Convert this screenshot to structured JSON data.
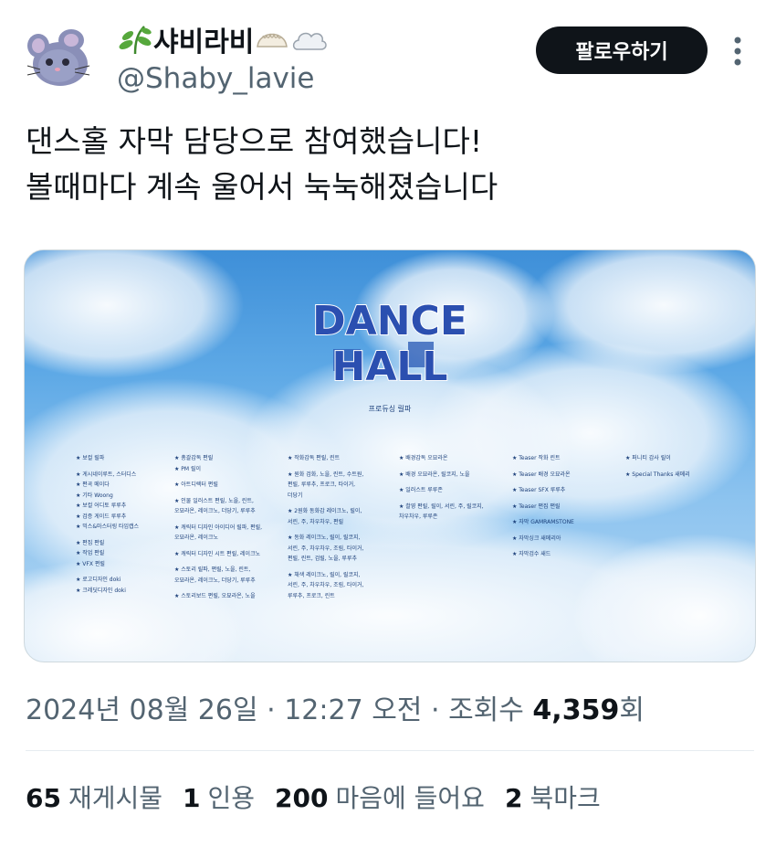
{
  "user": {
    "display_name": "샤비라비",
    "handle": "@Shaby_lavie",
    "avatar_icon": "chinchilla-avatar-icon",
    "name_icons": [
      "herb-icon",
      "dumpling-icon",
      "cloud-icon"
    ]
  },
  "actions": {
    "follow_label": "팔로우하기",
    "more_icon": "more-vertical-icon"
  },
  "tweet": {
    "lines": [
      "댄스홀 자막 담당으로 참여했습니다!",
      "볼때마다 계속 울어서 눅눅해졌습니다"
    ]
  },
  "media": {
    "logo_line1": "DANCE",
    "logo_line2": "HALL",
    "producer": "프로듀싱 릴파",
    "columns": [
      [
        [
          "★ 보컬 릴파"
        ],
        [
          "★ 게시네이루트, 스터디스",
          "★ 편곡 메이다",
          "★ 기타 Woong",
          "★ 보컬 어디토 루루추",
          "★ 검증 게이드 루루추",
          "★ 믹스&마스터링 타임캡스"
        ],
        [
          "★ 편집 편릴",
          "★ 작업 편릴",
          "★ VFX 편릴"
        ],
        [
          "★ 로고디자인 doki",
          "★ 크레딧디자인 doki"
        ]
      ],
      [
        [
          "★ 총괄감독 편릴",
          "★ PM 릴이"
        ],
        [
          "★ 아트디렉터 편릴"
        ],
        [
          "★ 인물 일러스트 편릴, 노을, 린트,",
          "   오묘라온, 레이크노, 더당기, 루루추"
        ],
        [
          "★ 캐릭터 디자인 아이디어 릴파, 편릴,",
          "   오묘라온, 레이크노"
        ],
        [
          "★ 캐릭터 디자인 시트 편릴, 레이크노"
        ],
        [
          "★ 스토리 릴파, 편릴, 노을, 린트,",
          "   오묘라온, 레이크노, 더당기, 루루추"
        ],
        [
          "★ 스토리보드 편릴, 오묘라온, 노을"
        ]
      ],
      [
        [
          "★ 작화감독 편릴, 린트"
        ],
        [
          "★ 원화 검화, 노을, 린트, 수트원,",
          "   편릴, 루루추, 프로크, 타이거,",
          "   더당기"
        ],
        [
          "★ 2원화 동화감 레이크노, 릴이,",
          "   서린, 주, 차우차우, 편릴"
        ],
        [
          "★ 동화 레이크노, 릴이, 릴코지,",
          "   서린, 주, 차우차우, 조림, 타이거,",
          "   편릴, 린트, 검릴, 노을, 루루추"
        ],
        [
          "★ 채색 레이크노, 릴이, 릴코지,",
          "   서린, 주, 차우차우, 조림, 타이거,",
          "   루루추, 프로크, 린트"
        ]
      ],
      [
        [
          "★ 배경감독 오묘라온"
        ],
        [
          "★ 배경 오묘라온, 릴코지, 노을"
        ],
        [
          "★ 일러스트 루루존"
        ],
        [
          "★ 촬영 편릴, 릴이, 서린, 주, 릴코지,",
          "   차우차우, 루루존"
        ]
      ],
      [
        [
          "★ Teaser 작화 린트"
        ],
        [
          "★ Teaser 배경 오묘라온"
        ],
        [
          "★ Teaser SFX 루루추"
        ],
        [
          "★ Teaser 편집 편릴"
        ],
        [
          "★ 자막 GAMRAMSTONE"
        ],
        [
          "★ 자막싱크 새메리아"
        ],
        [
          "★ 자막검수 새드"
        ]
      ],
      [
        [
          "★ 퍼니티 감사 릴이"
        ],
        [
          "★ Special Thanks 새메리"
        ]
      ]
    ]
  },
  "meta": {
    "date": "2024년 08월 26일",
    "separator": "·",
    "time": "12:27 오전",
    "views_label": "조회수",
    "views_count": "4,359",
    "views_suffix": "회"
  },
  "stats": [
    {
      "count": "65",
      "label": "재게시물"
    },
    {
      "count": "1",
      "label": "인용"
    },
    {
      "count": "200",
      "label": "마음에 들어요"
    },
    {
      "count": "2",
      "label": "북마크"
    }
  ]
}
